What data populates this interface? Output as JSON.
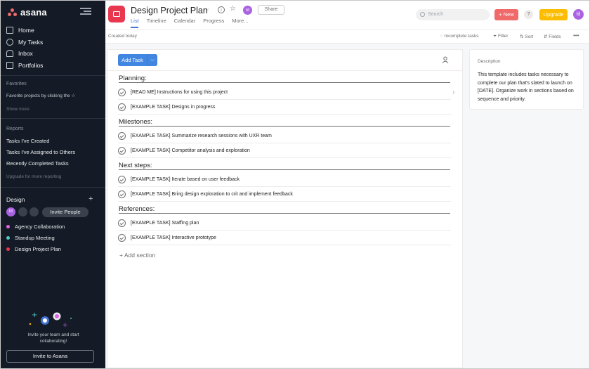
{
  "brand": {
    "name": "asana"
  },
  "sidebar": {
    "nav": [
      {
        "label": "Home",
        "icon": "home-icon"
      },
      {
        "label": "My Tasks",
        "icon": "check-circle-icon"
      },
      {
        "label": "Inbox",
        "icon": "bell-icon"
      },
      {
        "label": "Portfolios",
        "icon": "chart-icon"
      }
    ],
    "favorites_label": "Favorites",
    "favorites_hint": "Favorite projects by clicking the ☆",
    "show_more": "Show more",
    "reports_label": "Reports",
    "reports": [
      "Tasks I've Created",
      "Tasks I've Assigned to Others",
      "Recently Completed Tasks"
    ],
    "upgrade_reporting": "Upgrade for more reporting",
    "team_name": "Design",
    "team_add": "+",
    "member_avatar": "ld",
    "invite_people": "Invite People",
    "projects": [
      {
        "name": "Agency Collaboration",
        "color": "#e362e3"
      },
      {
        "name": "Standup Meeting",
        "color": "#4ecbc4"
      },
      {
        "name": "Design Project Plan",
        "color": "#e8384f"
      }
    ],
    "invite_text": "Invite your team and start collaborating!",
    "invite_button": "Invite to Asana"
  },
  "header": {
    "title": "Design Project Plan",
    "avatar": "ld",
    "share": "Share",
    "tabs": [
      "List",
      "Timeline",
      "Calendar",
      "Progress",
      "More..."
    ],
    "search_placeholder": "Search",
    "new_button": "+ New",
    "help": "?",
    "upgrade": "Upgrade",
    "user_avatar": "ld"
  },
  "toolbar": {
    "created": "Created today",
    "incomplete": "Incomplete tasks",
    "filter": "Filter",
    "sort": "Sort",
    "fields": "Fields",
    "more": "•••"
  },
  "list": {
    "add_task": "Add Task",
    "sections": [
      {
        "title": "Planning:",
        "tasks": [
          "[READ ME] Instructions for using this project",
          "[EXAMPLE TASK] Designs in progress"
        ]
      },
      {
        "title": "Milestones:",
        "tasks": [
          "[EXAMPLE TASK] Summarize research sessions with UXR team",
          "[EXAMPLE TASK] Competitor analysis and exploration"
        ]
      },
      {
        "title": "Next steps:",
        "tasks": [
          "[EXAMPLE TASK] Iterate based on user feedback",
          "[EXAMPLE TASK] Bring design exploration to crit and implement feedback"
        ]
      },
      {
        "title": "References:",
        "tasks": [
          "[EXAMPLE TASK] Staffing plan",
          "[EXAMPLE TASK] Interactive prototype"
        ]
      }
    ],
    "add_section": "+ Add section"
  },
  "description": {
    "title": "Description",
    "text": "This template includes tasks necessary to complete our plan that's slated to launch on [DATE]. Organize work in sections based on sequence and priority."
  }
}
